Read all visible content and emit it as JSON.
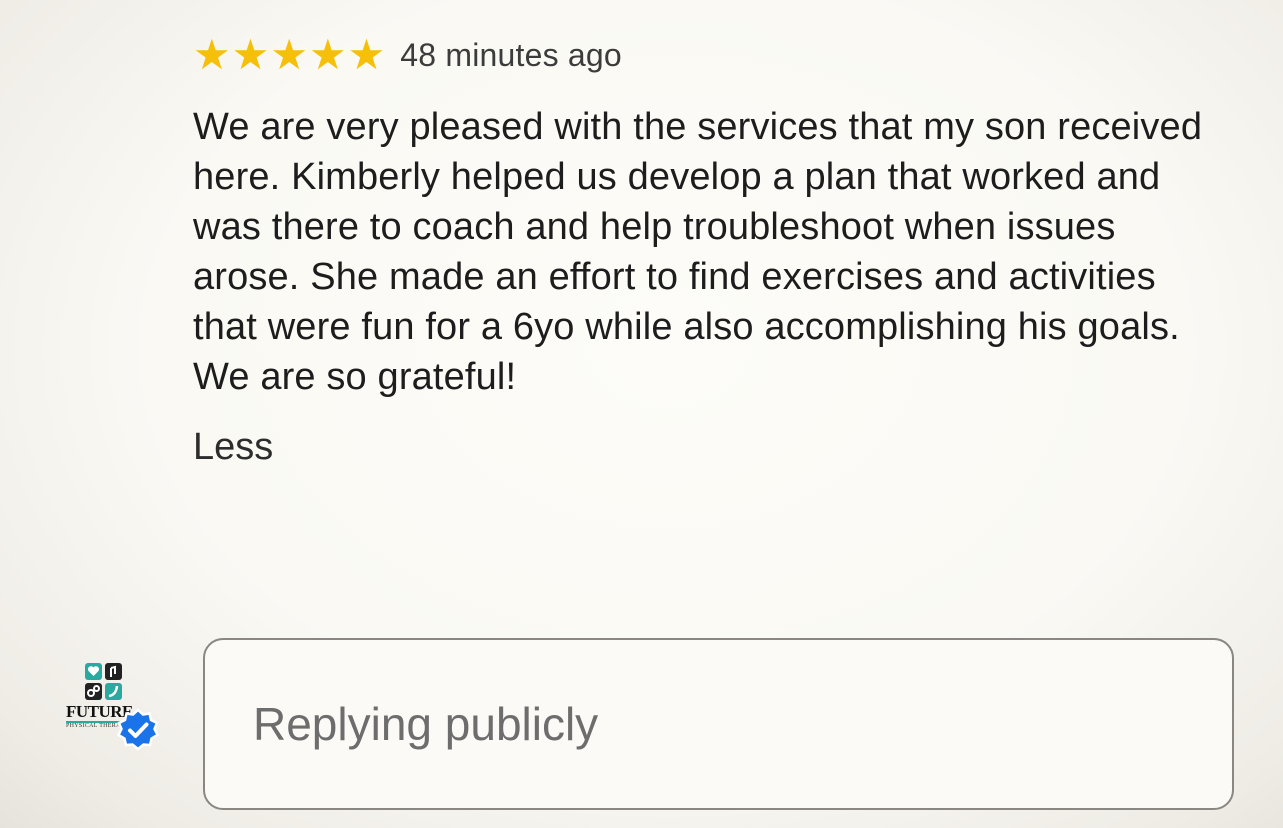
{
  "review": {
    "rating": 5,
    "rating_max": 5,
    "star_color": "#f5bf0a",
    "time": "48 minutes ago",
    "text": "We are very pleased with the services that my son received here. Kimberly helped us develop a plan that worked and was there to coach and help troubleshoot when issues arose. She made an effort to find exercises and activities that were fun for a 6yo while also accomplishing his goals. We are so grateful!",
    "less_label": "Less"
  },
  "owner": {
    "logo_name": "FUTURE",
    "logo_subtitle": "PHYSICAL THERAPY",
    "verified_badge_color": "#1a73e8",
    "logo_icon": "future-physical-therapy-logo",
    "badge_icon": "verified-check-icon"
  },
  "reply": {
    "placeholder": "Replying publicly",
    "value": ""
  },
  "colors": {
    "logo_teal": "#2aa9a1",
    "logo_dark": "#222222"
  }
}
